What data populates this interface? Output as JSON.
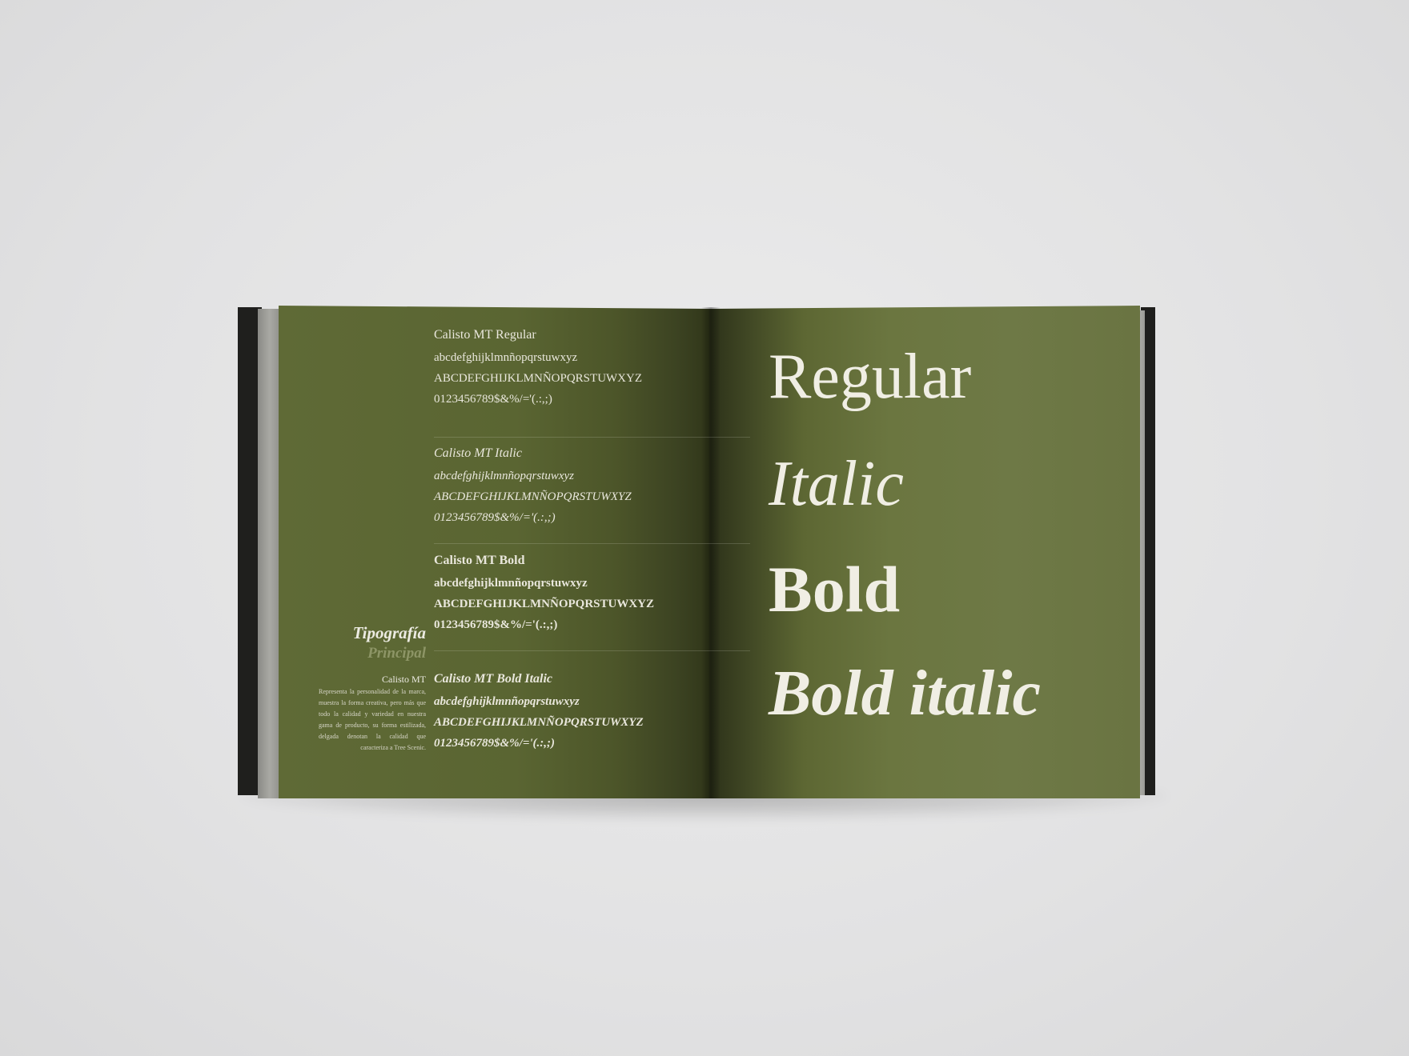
{
  "left_page": {
    "section_title": "Tipografía",
    "section_subtitle": "Principal",
    "font_caption": "Calisto MT",
    "description": "Representa la personalidad de la marca, muestra la forma creativa, pero más que todo la calidad y variedad en nuestra gama de producto, su forma estilizada, delgada denotan la calidad que caracteriza a Tree Scenic.",
    "specimens": [
      {
        "name": "Calisto MT Regular",
        "lowercase": "abcdefghijklmnñopqrstuwxyz",
        "uppercase": "ABCDEFGHIJKLMNÑOPQRSTUWXYZ",
        "numerals": "0123456789$&%/='(.:,;)"
      },
      {
        "name": "Calisto MT Italic",
        "lowercase": "abcdefghijklmnñopqrstuwxyz",
        "uppercase": "ABCDEFGHIJKLMNÑOPQRSTUWXYZ",
        "numerals": "0123456789$&%/='(.:,;)"
      },
      {
        "name": "Calisto MT Bold",
        "lowercase": "abcdefghijklmnñopqrstuwxyz",
        "uppercase": "ABCDEFGHIJKLMNÑOPQRSTUWXYZ",
        "numerals": "0123456789$&%/='(.:,;)"
      },
      {
        "name": "Calisto MT Bold Italic",
        "lowercase": "abcdefghijklmnñopqrstuwxyz",
        "uppercase": "ABCDEFGHIJKLMNÑOPQRSTUWXYZ",
        "numerals": "0123456789$&%/='(.:,;)"
      }
    ]
  },
  "right_page": {
    "styles": [
      "Regular",
      "Italic",
      "Bold",
      "Bold italic"
    ]
  },
  "colors": {
    "page_green": "#6b7640",
    "text_cream": "#f0eee4",
    "subtitle_green": "#8d9566",
    "background": "#e4e4e5"
  }
}
